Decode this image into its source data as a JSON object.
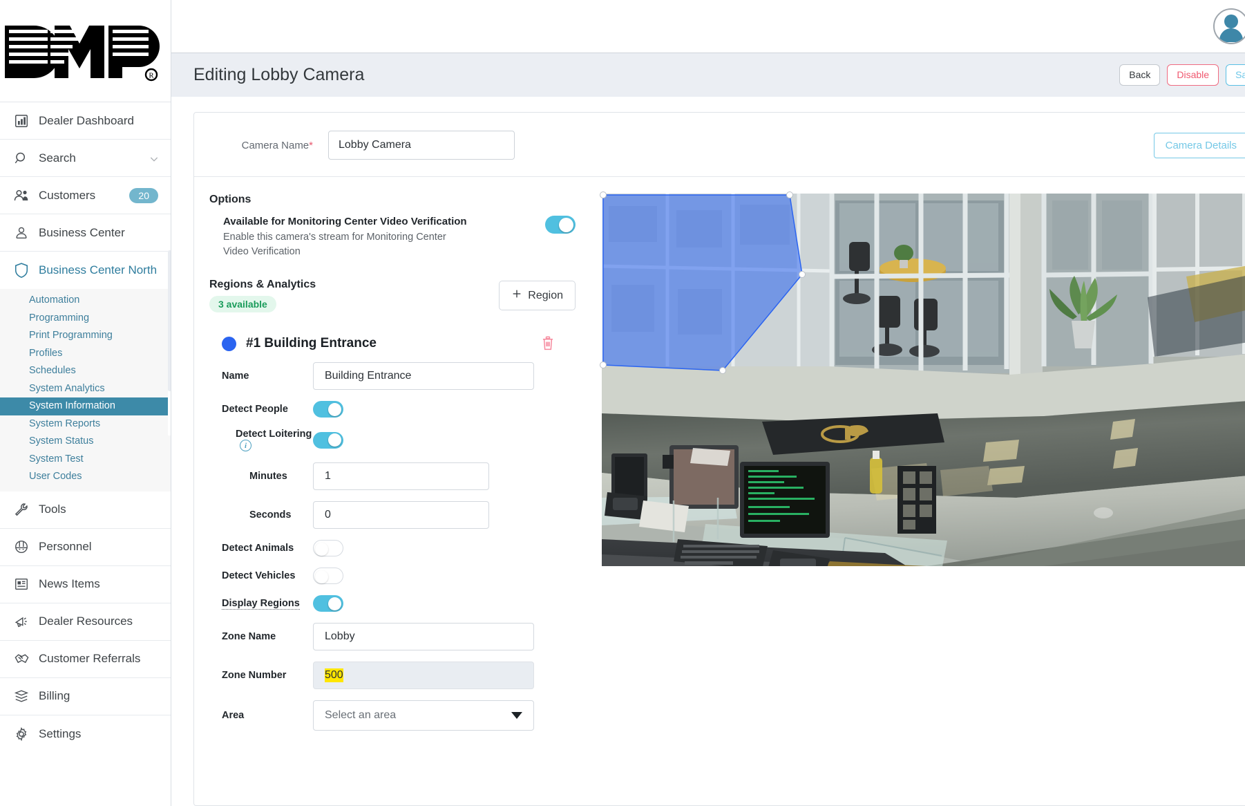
{
  "brand": {
    "logo_text": "DMP",
    "logo_mark": "registered"
  },
  "topbar": {
    "avatar_icon": "user-avatar-icon",
    "caret_icon": "chevron-down-icon"
  },
  "sidebar": {
    "items": [
      {
        "label": "Dealer Dashboard",
        "icon": "dashboard-icon"
      },
      {
        "label": "Search",
        "icon": "search-icon",
        "trailing_icon": "chevron-down-icon"
      },
      {
        "label": "Customers",
        "icon": "customers-icon",
        "badge": "20"
      },
      {
        "label": "Business Center",
        "icon": "person-icon"
      },
      {
        "label": "Business Center North",
        "icon": "shield-icon",
        "active_parent": true
      }
    ],
    "subnav": [
      {
        "label": "Automation"
      },
      {
        "label": "Programming"
      },
      {
        "label": "Print Programming"
      },
      {
        "label": "Profiles"
      },
      {
        "label": "Schedules"
      },
      {
        "label": "System Analytics"
      },
      {
        "label": "System Information",
        "selected": true
      },
      {
        "label": "System Reports"
      },
      {
        "label": "System Status"
      },
      {
        "label": "System Test"
      },
      {
        "label": "User Codes"
      }
    ],
    "items_bottom": [
      {
        "label": "Tools",
        "icon": "wrench-icon"
      },
      {
        "label": "Personnel",
        "icon": "hardhat-icon"
      },
      {
        "label": "News Items",
        "icon": "newspaper-icon"
      },
      {
        "label": "Dealer Resources",
        "icon": "megaphone-icon"
      },
      {
        "label": "Customer Referrals",
        "icon": "handshake-icon"
      },
      {
        "label": "Billing",
        "icon": "billing-icon"
      },
      {
        "label": "Settings",
        "icon": "gear-icon"
      }
    ]
  },
  "header": {
    "title": "Editing Lobby Camera",
    "buttons": {
      "back": "Back",
      "disable": "Disable",
      "save": "Save"
    }
  },
  "form": {
    "camera_name_label": "Camera Name",
    "camera_name_required_mark": "*",
    "camera_name_value": "Lobby Camera",
    "camera_details_button": "Camera Details"
  },
  "options": {
    "section_title": "Options",
    "video_verification": {
      "title": "Available for Monitoring Center Video Verification",
      "description": "Enable this camera's stream for Monitoring Center Video Verification",
      "enabled": "on"
    }
  },
  "regions_analytics": {
    "title": "Regions & Analytics",
    "available_badge": "3 available",
    "add_region_button": "Region",
    "add_icon": "plus-icon"
  },
  "region": {
    "index_label": "#1",
    "name_heading": "Building Entrance",
    "color": "#2b64f0",
    "delete_icon": "trash-icon",
    "fields": {
      "name_label": "Name",
      "name_value": "Building Entrance",
      "detect_people_label": "Detect People",
      "detect_people": "on",
      "detect_loitering_label": "Detect Loitering",
      "detect_loitering_info_icon": "info-icon",
      "detect_loitering": "on",
      "minutes_label": "Minutes",
      "minutes_value": "1",
      "seconds_label": "Seconds",
      "seconds_value": "0",
      "detect_animals_label": "Detect Animals",
      "detect_animals": "off",
      "detect_vehicles_label": "Detect Vehicles",
      "detect_vehicles": "off",
      "display_regions_label": "Display Regions",
      "display_regions": "on",
      "zone_name_label": "Zone Name",
      "zone_name_value": "Lobby",
      "zone_number_label": "Zone Number",
      "zone_number_value": "500",
      "area_label": "Area",
      "area_placeholder": "Select an area"
    }
  },
  "camera_preview": {
    "alt": "Lobby camera live view showing reception desk, glass office walls, polished stone floor and potted plant",
    "region_overlay_color": "#2b64f0",
    "region_overlay_opacity": "0.55",
    "handle_icon": "resize-handle-icon"
  },
  "colors": {
    "accent_teal": "#3d8aa8",
    "toggle_on": "#50c0e0",
    "danger": "#f0586f",
    "primary_outline": "#58bfe4",
    "success_green": "#1a9c5b",
    "header_bg": "#ebeef3"
  }
}
